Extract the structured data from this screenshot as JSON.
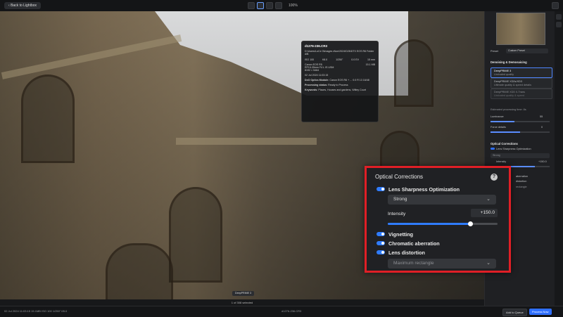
{
  "topbar": {
    "back_label": "Back to Lightbox",
    "zoom": "100%"
  },
  "info_popup": {
    "filename": "d1276-236.CR3",
    "path": "D:\\Users\\LoCe 0\\Images d\\ion\\2024\\D26\\DTX EOS R6 Folder d\\B",
    "specs": [
      "ISO 100",
      "f/8.0",
      "1/250\"",
      "0.0 EV",
      "15 mm"
    ],
    "camera": "Canon EOS R5",
    "camera_right": "15.1 MB",
    "lens": "RF15-35mm F4 L IS USM",
    "dims": "8192 × 5464",
    "date": "02 Jul 2024 11:03:15",
    "dxo_optics_module": "Canon EOS R6 + ... 0.0 R 13 16/48",
    "processing_status": "Ready to Process",
    "keywords": "Places, Houses and gardens, Witley Court",
    "label_module": "DxO Optics Module:",
    "label_status": "Processing status:",
    "label_keywords": "Keywords:"
  },
  "preset_pill": "DeepPRIME 3",
  "selected_count": "1 of 308 selected",
  "sidebar": {
    "preset_label": "Preset",
    "preset_value": "Custom Preset",
    "section_denoise": "Denoising & Demosaicing",
    "deepprime3": "DeepPRIME 3",
    "deepprime3_sub": "Unrivaled quality",
    "deepprimexd": "DeepPRIME XD2s/XD3",
    "deepprimexd_sub": "Ultimate quality & speed details",
    "deepprime_xd3": "DeepPRIME XD3 X-Trans",
    "deepprime_xd3_sub": "Unrivaled quality & speed",
    "est_time": "Estimated processing time: 8s",
    "luminance_label": "Luminance",
    "luminance_value": "55",
    "force_details": "Force details",
    "force_details_value": "0",
    "section_optical": "Optical Corrections",
    "lens_sharpness": "Lens Sharpness Optimization",
    "strong": "Strong",
    "intensity": "Intensity",
    "intensity_value": "+150.0",
    "aberration": "aberration",
    "distortion": "distortion",
    "rectangle": "rectangle"
  },
  "optical_panel": {
    "title": "Optical Corrections",
    "help": "?",
    "lens_sharpness": "Lens Sharpness Optimization",
    "mode": "Strong",
    "intensity_label": "Intensity",
    "intensity_value": "+150.0",
    "intensity_level": 0.75,
    "vignetting": "Vignetting",
    "chromatic": "Chromatic aberration",
    "lens_distortion": "Lens distortion",
    "distortion_mode": "Maximum rectangle"
  },
  "statusbar": {
    "left": "02 Jul 2024 11:03:15   15.1MB   ISO 100   1/250\"   f/8.0",
    "middle": "d1276-236.CR3",
    "add_queue": "Add to Queue",
    "process_now": "Process Now"
  },
  "colors": {
    "accent": "#2f7cff",
    "highlight": "#e01f26"
  }
}
